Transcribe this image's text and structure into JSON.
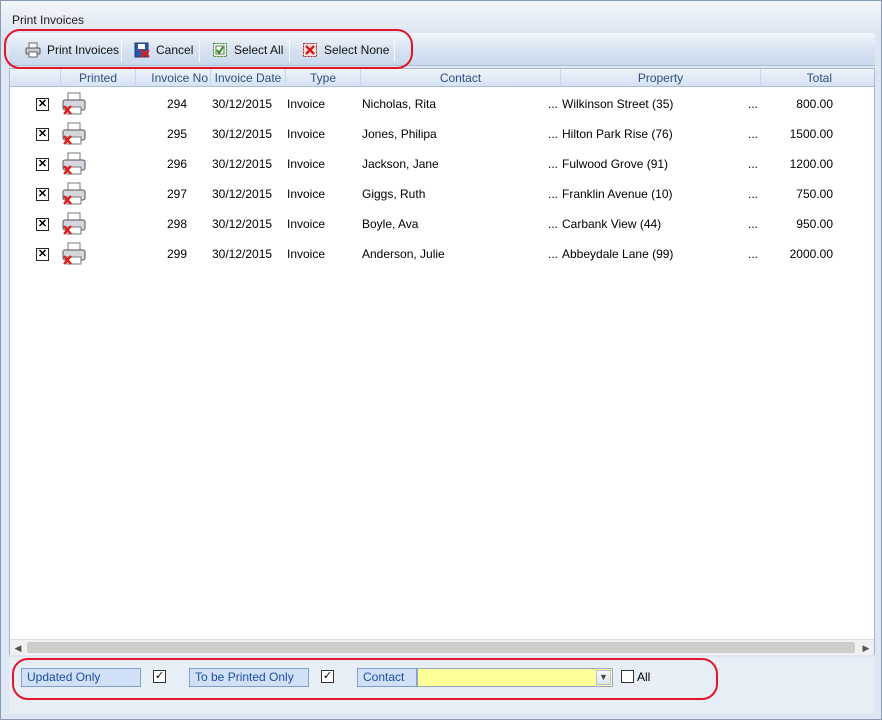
{
  "window": {
    "title": "Print Invoices"
  },
  "toolbar": {
    "print_label": "Print Invoices",
    "cancel_label": "Cancel",
    "select_all_label": "Select All",
    "select_none_label": "Select None"
  },
  "grid": {
    "columns": {
      "printed": "Printed",
      "invoice_no": "Invoice No",
      "invoice_date": "Invoice Date",
      "type": "Type",
      "contact": "Contact",
      "property": "Property",
      "total": "Total"
    },
    "rows": [
      {
        "selected": true,
        "invoice_no": "294",
        "invoice_date": "30/12/2015",
        "type": "Invoice",
        "contact": "Nicholas, Rita",
        "contact_more": "...",
        "property": "Wilkinson Street (35)",
        "property_more": "...",
        "total": "800.00"
      },
      {
        "selected": true,
        "invoice_no": "295",
        "invoice_date": "30/12/2015",
        "type": "Invoice",
        "contact": "Jones, Philipa",
        "contact_more": "...",
        "property": "Hilton Park Rise (76)",
        "property_more": "...",
        "total": "1500.00"
      },
      {
        "selected": true,
        "invoice_no": "296",
        "invoice_date": "30/12/2015",
        "type": "Invoice",
        "contact": "Jackson, Jane",
        "contact_more": "...",
        "property": "Fulwood Grove (91)",
        "property_more": "...",
        "total": "1200.00"
      },
      {
        "selected": true,
        "invoice_no": "297",
        "invoice_date": "30/12/2015",
        "type": "Invoice",
        "contact": "Giggs, Ruth",
        "contact_more": "...",
        "property": "Franklin Avenue (10)",
        "property_more": "...",
        "total": "750.00"
      },
      {
        "selected": true,
        "invoice_no": "298",
        "invoice_date": "30/12/2015",
        "type": "Invoice",
        "contact": "Boyle, Ava",
        "contact_more": "...",
        "property": "Carbank View (44)",
        "property_more": "...",
        "total": "950.00"
      },
      {
        "selected": true,
        "invoice_no": "299",
        "invoice_date": "30/12/2015",
        "type": "Invoice",
        "contact": "Anderson, Julie",
        "contact_more": "...",
        "property": "Abbeydale Lane (99)",
        "property_more": "...",
        "total": "2000.00"
      }
    ],
    "check_mark": "✕"
  },
  "filters": {
    "updated_only_label": "Updated Only",
    "updated_only_checked": true,
    "to_be_printed_label": "To be Printed Only",
    "to_be_printed_checked": true,
    "contact_label": "Contact",
    "contact_value": "",
    "all_label": "All",
    "all_checked": false,
    "checked_glyph": "✓"
  },
  "icons": {
    "print": "printer-icon",
    "cancel": "cancel-icon",
    "select_all": "select-all-icon",
    "select_none": "select-none-icon",
    "row_status": "printer-not-printed-icon",
    "dropdown": "chevron-down-icon"
  },
  "colors": {
    "highlight_oval": "#e0162b",
    "combo_background": "#ffff99",
    "label_text": "#1f4ea3",
    "label_background": "#cfe0f7",
    "header_text": "#2f4f7f"
  }
}
